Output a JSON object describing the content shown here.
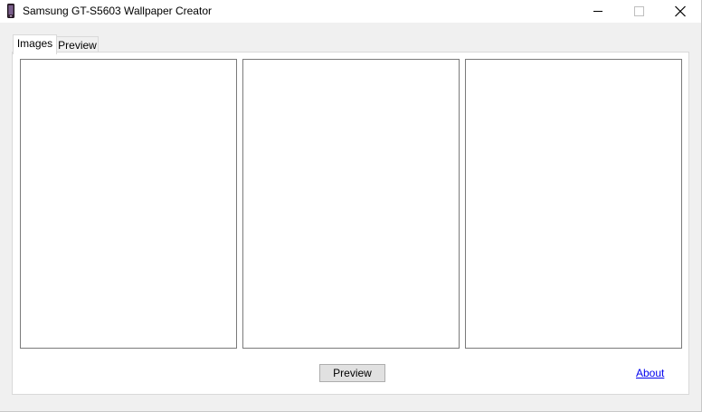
{
  "window": {
    "title": "Samsung GT-S5603 Wallpaper Creator"
  },
  "tabs": [
    {
      "label": "Images",
      "selected": true
    },
    {
      "label": "Preview",
      "selected": false
    }
  ],
  "images_tab": {
    "image_slots": 3
  },
  "footer": {
    "preview_button_label": "Preview",
    "about_link_label": "About"
  },
  "colors": {
    "window_bg": "#f0f0f0",
    "panel_bg": "#ffffff",
    "link": "#0000ee",
    "button_bg": "#e1e1e1",
    "slot_border": "#7a7a7a"
  }
}
